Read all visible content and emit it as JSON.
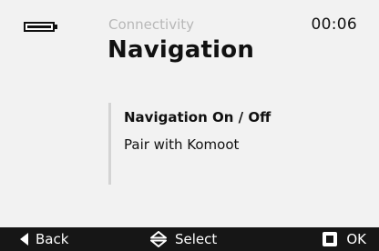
{
  "status": {
    "time": "00:06",
    "battery_level": 1.0
  },
  "header": {
    "breadcrumb": "Connectivity",
    "title": "Navigation"
  },
  "menu": {
    "items": [
      {
        "label": "Navigation On / Off",
        "selected": true
      },
      {
        "label": "Pair with Komoot",
        "selected": false
      }
    ]
  },
  "bottom_bar": {
    "back_label": "Back",
    "back_icon": "triangle-left-icon",
    "select_label": "Select",
    "select_icon": "up-down-arrows-icon",
    "ok_label": "OK",
    "ok_icon": "square-button-icon"
  },
  "colors": {
    "background": "#f2f2f2",
    "bottom_bar": "#161616",
    "breadcrumb": "#b8b8b8",
    "rail": "#d4d4d4"
  }
}
